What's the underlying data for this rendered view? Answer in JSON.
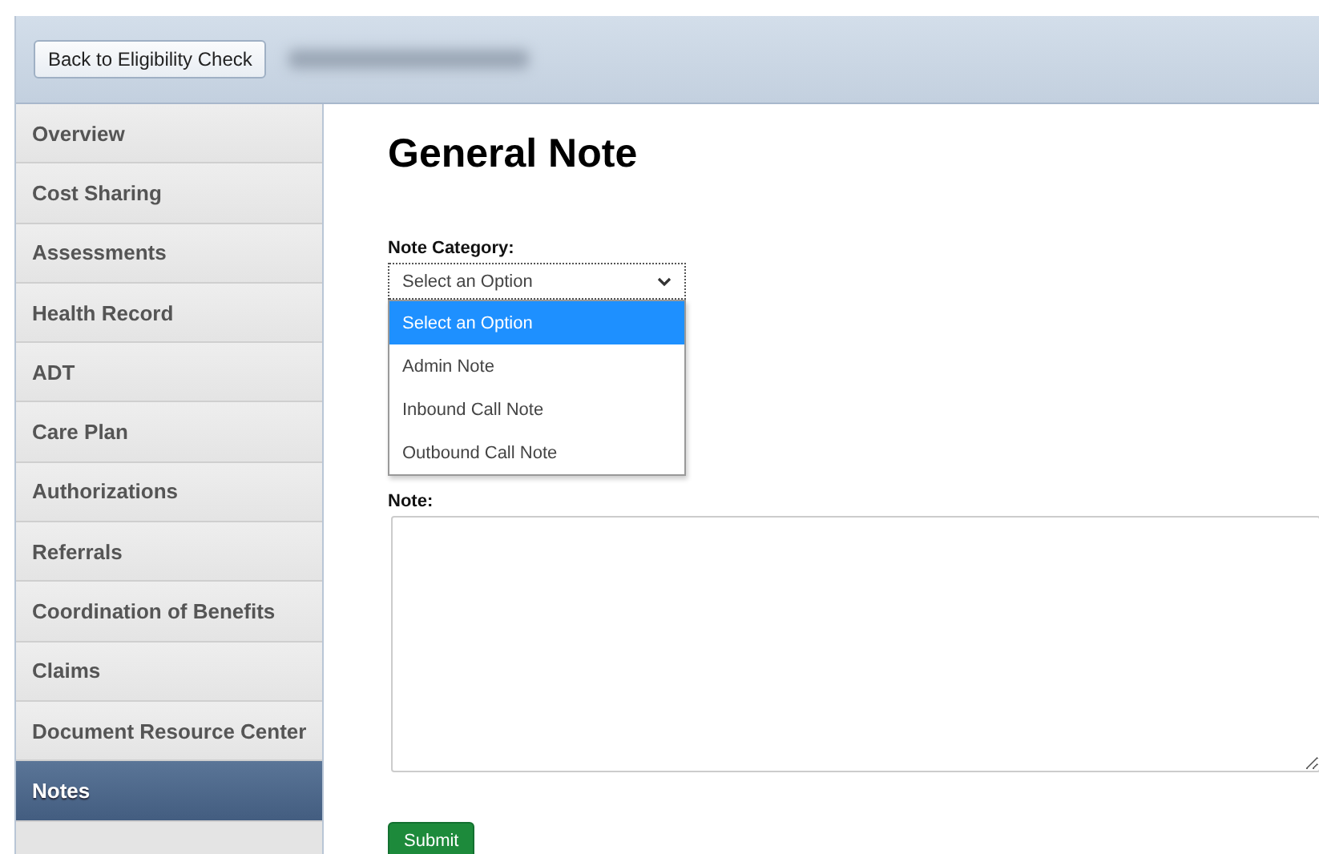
{
  "header": {
    "back_button": "Back to Eligibility Check"
  },
  "sidebar": {
    "items": [
      {
        "label": "Overview",
        "selected": false
      },
      {
        "label": "Cost Sharing",
        "selected": false
      },
      {
        "label": "Assessments",
        "selected": false
      },
      {
        "label": "Health Record",
        "selected": false
      },
      {
        "label": "ADT",
        "selected": false
      },
      {
        "label": "Care Plan",
        "selected": false
      },
      {
        "label": "Authorizations",
        "selected": false
      },
      {
        "label": "Referrals",
        "selected": false
      },
      {
        "label": "Coordination of Benefits",
        "selected": false
      },
      {
        "label": "Claims",
        "selected": false
      },
      {
        "label": "Document Resource Center",
        "selected": false
      },
      {
        "label": "Notes",
        "selected": true
      }
    ]
  },
  "main": {
    "title": "General Note",
    "category": {
      "label": "Note Category:",
      "value": "Select an Option",
      "expanded": true,
      "options": [
        {
          "label": "Select an Option",
          "selected": true
        },
        {
          "label": "Admin Note",
          "selected": false
        },
        {
          "label": "Inbound Call Note",
          "selected": false
        },
        {
          "label": "Outbound Call Note",
          "selected": false
        }
      ]
    },
    "note": {
      "label": "Note:"
    },
    "submit": "Submit"
  }
}
